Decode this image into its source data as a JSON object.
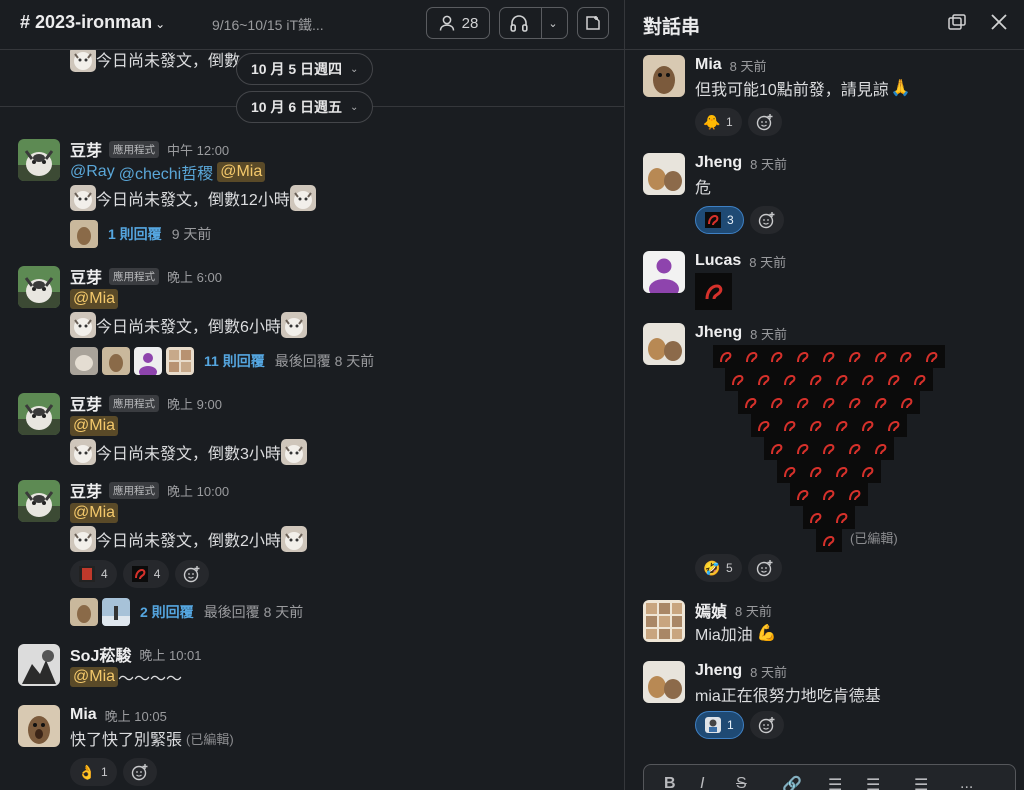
{
  "channel": {
    "name": "2023-ironman",
    "topic": "9/16~10/15 iT鐵...",
    "member_count": "28"
  },
  "date_pills": [
    "10 月 5 日週四",
    "10 月 6 日週五"
  ],
  "prev_line": "今日尚未發文，倒數",
  "messages": [
    {
      "user": "豆芽",
      "badge": "應用程式",
      "time": "中午 12:00",
      "mentions": [
        "@Ray",
        "@chechi哲稷"
      ],
      "mention_hl": "@Mia",
      "text": "今日尚未發文，倒數12小時",
      "reply_count": "1 則回覆",
      "reply_time": "9 天前"
    },
    {
      "user": "豆芽",
      "badge": "應用程式",
      "time": "晚上 6:00",
      "mention_hl": "@Mia",
      "text": "今日尚未發文，倒數6小時",
      "reply_count": "11 則回覆",
      "reply_time": "最後回覆 8 天前"
    },
    {
      "user": "豆芽",
      "badge": "應用程式",
      "time": "晚上 9:00",
      "mention_hl": "@Mia",
      "text": "今日尚未發文，倒數3小時"
    },
    {
      "user": "豆芽",
      "badge": "應用程式",
      "time": "晚上 10:00",
      "mention_hl": "@Mia",
      "text": "今日尚未發文，倒數2小時",
      "reactions": [
        "4",
        "4"
      ],
      "reply_count": "2 則回覆",
      "reply_time": "最後回覆 8 天前"
    },
    {
      "user": "SoJ菘駿",
      "time": "晚上 10:01",
      "mention_hl": "@Mia",
      "text": "～～～～"
    },
    {
      "user": "Mia",
      "time": "晚上 10:05",
      "text": "快了快了別緊張",
      "edited": "(已編輯)",
      "reactions": [
        "1"
      ]
    }
  ],
  "thread": {
    "title": "對話串",
    "messages": [
      {
        "user": "Mia",
        "time": "8 天前",
        "text": "但我可能10點前發，請見諒",
        "reactions": [
          "1"
        ]
      },
      {
        "user": "Jheng",
        "time": "8 天前",
        "text": "危",
        "reactions": [
          "3"
        ]
      },
      {
        "user": "Lucas",
        "time": "8 天前"
      },
      {
        "user": "Jheng",
        "time": "8 天前",
        "edited": "(已編輯)",
        "reactions": [
          "5"
        ]
      },
      {
        "user": "嫣媜",
        "time": "8 天前",
        "text": "Mia加油"
      },
      {
        "user": "Jheng",
        "time": "8 天前",
        "text": "mia正在很努力地吃肯德基",
        "reactions": [
          "1"
        ]
      }
    ]
  },
  "composer": {
    "bold": "B",
    "italic": "I",
    "strike": "S",
    "more": "..."
  },
  "colors": {
    "background": "#1a1d21",
    "mention_bg": "#5a4a28",
    "mention_text": "#f3c86b",
    "link": "#55a6e0",
    "active_reaction": "#1f4a74"
  },
  "icons": [
    "hash-icon",
    "person-icon",
    "headphones-icon",
    "chevron-down-icon",
    "canvas-icon",
    "popout-icon",
    "close-icon",
    "add-reaction-icon",
    "danger-emoji-icon",
    "flexed-biceps-icon"
  ]
}
